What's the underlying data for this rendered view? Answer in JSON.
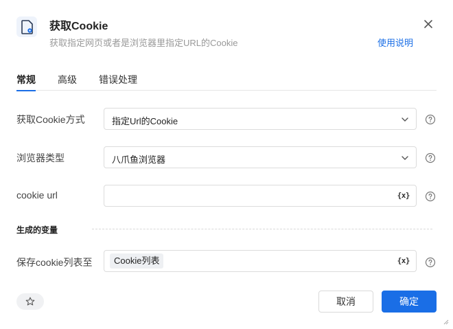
{
  "dialog": {
    "title": "获取Cookie",
    "subtitle": "获取指定网页或者是浏览器里指定URL的Cookie",
    "help_link": "使用说明",
    "icon": "document-gear-icon"
  },
  "tabs": [
    {
      "label": "常规",
      "active": true
    },
    {
      "label": "高级",
      "active": false
    },
    {
      "label": "错误处理",
      "active": false
    }
  ],
  "form": {
    "method": {
      "label": "获取Cookie方式",
      "value": "指定Url的Cookie"
    },
    "browser": {
      "label": "浏览器类型",
      "value": "八爪鱼浏览器"
    },
    "cookie_url": {
      "label": "cookie url",
      "value": ""
    },
    "section_title": "生成的变量",
    "save_to": {
      "label": "保存cookie列表至",
      "chip": "Cookie列表"
    },
    "var_button": "{x}"
  },
  "footer": {
    "cancel": "取消",
    "ok": "确定"
  },
  "colors": {
    "accent": "#1a6ee6"
  }
}
